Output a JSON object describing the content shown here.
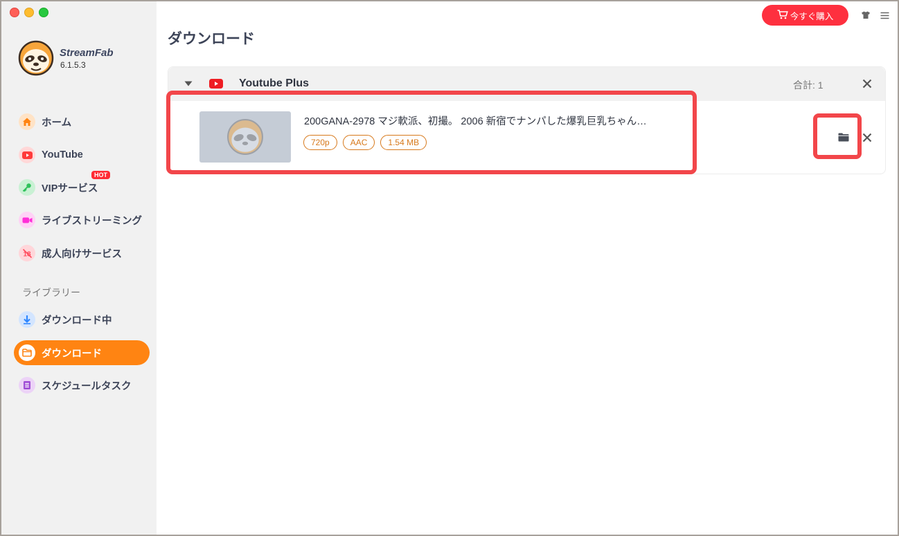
{
  "app": {
    "brand": "StreamFab",
    "version": "6.1.5.3",
    "buy_label": "今すぐ購入"
  },
  "sidebar": {
    "items": [
      {
        "label": "ホーム",
        "icon": "home-icon",
        "color": "#ff8412"
      },
      {
        "label": "YouTube",
        "icon": "youtube-icon",
        "color": "#ff3b3b"
      },
      {
        "label": "VIPサービス",
        "icon": "key-icon",
        "color": "#2fc15b",
        "badge": "HOT"
      },
      {
        "label": "ライブストリーミング",
        "icon": "video-camera-icon",
        "color": "#ff2fd8"
      },
      {
        "label": "成人向けサービス",
        "icon": "adult-18-icon",
        "color": "#ff4d5e"
      }
    ],
    "library_label": "ライブラリー",
    "library_items": [
      {
        "label": "ダウンロード中",
        "icon": "download-arrow-icon",
        "color": "#2f87ff"
      },
      {
        "label": "ダウンロード",
        "icon": "folder-icon",
        "color": "#ff8412",
        "active": true
      },
      {
        "label": "スケジュールタスク",
        "icon": "schedule-list-icon",
        "color": "#a14fd6"
      }
    ]
  },
  "main": {
    "title": "ダウンロード",
    "group": {
      "name": "Youtube Plus",
      "count_text": "合計: 1",
      "items": [
        {
          "title": "200GANA-2978 マジ軟派、初撮。 2006 新宿でナンパした爆乳巨乳ちゃん…",
          "tags": [
            "720p",
            "AAC",
            "1.54 MB"
          ]
        }
      ]
    }
  },
  "colors": {
    "accent": "#ff8412",
    "buy": "#fe303f",
    "highlight": "#f2464a",
    "tag": "#d7781a"
  }
}
